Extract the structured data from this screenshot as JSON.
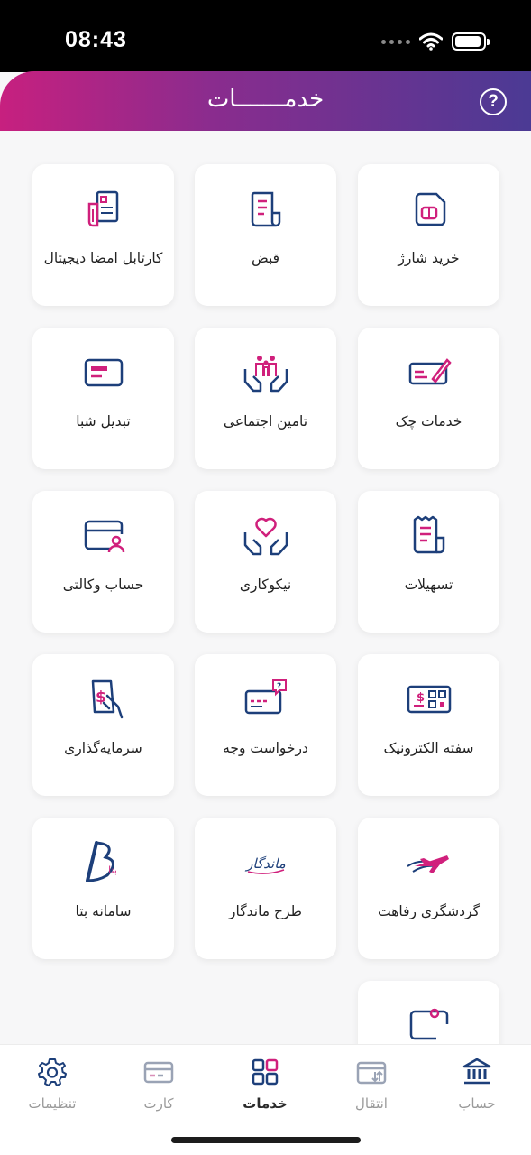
{
  "status_bar": {
    "time": "08:43"
  },
  "header": {
    "title": "خدمـــــــات",
    "help_icon": "?"
  },
  "services": [
    {
      "label": "خرید شارژ",
      "icon": "sim-card-icon"
    },
    {
      "label": "قبض",
      "icon": "bill-icon"
    },
    {
      "label": "کارتابل امضا دیجیتال",
      "icon": "digital-signature-icon"
    },
    {
      "label": "خدمات چک",
      "icon": "cheque-icon"
    },
    {
      "label": "تامین اجتماعی",
      "icon": "social-security-icon"
    },
    {
      "label": "تبدیل شبا",
      "icon": "sheba-card-icon"
    },
    {
      "label": "تسهیلات",
      "icon": "facilities-icon"
    },
    {
      "label": "نیکوکاری",
      "icon": "charity-icon"
    },
    {
      "label": "حساب وکالتی",
      "icon": "proxy-account-icon"
    },
    {
      "label": "سفته الکترونیک",
      "icon": "e-promissory-icon"
    },
    {
      "label": "درخواست وجه",
      "icon": "money-request-icon"
    },
    {
      "label": "سرمایه‌گذاری",
      "icon": "investment-icon"
    },
    {
      "label": "گردشگری رفاهت",
      "icon": "tourism-plane-icon"
    },
    {
      "label": "طرح ماندگار",
      "icon": "mandegar-logo-icon",
      "logo_text": "ماندگار"
    },
    {
      "label": "سامانه بتا",
      "icon": "beta-logo-icon",
      "logo_text": "بتا"
    },
    {
      "label": "",
      "icon": "partial-tile-icon"
    }
  ],
  "bottom_nav": [
    {
      "label": "حساب",
      "icon": "bank-icon",
      "active": false
    },
    {
      "label": "انتقال",
      "icon": "transfer-icon",
      "active": false
    },
    {
      "label": "خدمات",
      "icon": "grid-icon",
      "active": true
    },
    {
      "label": "کارت",
      "icon": "card-icon",
      "active": false
    },
    {
      "label": "تنظیمات",
      "icon": "gear-icon",
      "active": false
    }
  ],
  "colors": {
    "navy": "#1d3f7a",
    "pink": "#d0207c",
    "header_start": "#c7207f",
    "header_end": "#4b3a94"
  }
}
